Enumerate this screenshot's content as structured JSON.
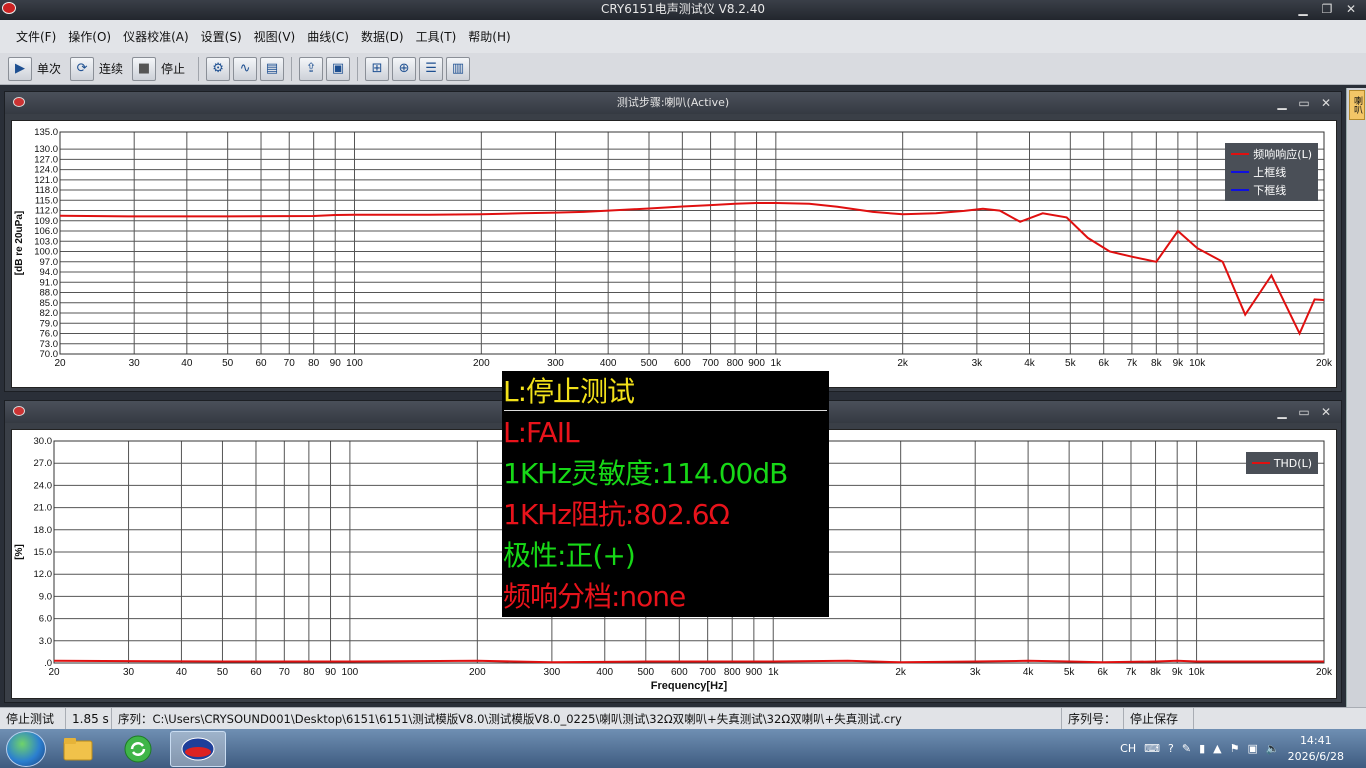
{
  "window": {
    "title": "CRY6151电声测试仪 V8.2.40"
  },
  "menu": [
    "文件(F)",
    "操作(O)",
    "仪器校准(A)",
    "设置(S)",
    "视图(V)",
    "曲线(C)",
    "数据(D)",
    "工具(T)",
    "帮助(H)"
  ],
  "toolbar": {
    "single_label": "单次",
    "continuous_label": "连续",
    "stop_label": "停止"
  },
  "right_tab_label": "喇叭",
  "panel1": {
    "title": "测试步骤:喇叭(Active)"
  },
  "panel2": {
    "title": ""
  },
  "overlay": {
    "status": "L:停止测试",
    "result": "L:FAIL",
    "sensitivity": "1KHz灵敏度:114.00dB",
    "impedance": "1KHz阻抗:802.6Ω",
    "polarity": "极性:正(+)",
    "grading": "频响分档:none"
  },
  "status": {
    "state": "停止测试",
    "time": "1.85 s",
    "sequence": "序列：C:\\Users\\CRYSOUND001\\Desktop\\6151\\6151\\测试模版V8.0\\测试模版V8.0_0225\\喇叭测试\\32Ω双喇叭+失真测试\\32Ω双喇叭+失真测试.cry",
    "serial_label": "序列号：",
    "save": "停止保存"
  },
  "tray": {
    "lang": "CH",
    "time": "14:41",
    "date": "2026/6/28"
  },
  "colors": {
    "fr_curve": "#e01010",
    "upper_limit": "#1010e0",
    "lower_limit": "#1010e0",
    "thd_curve": "#e01010"
  },
  "chart_data": [
    {
      "type": "line",
      "xscale": "log",
      "xlim": [
        20,
        20000
      ],
      "ylim": [
        70,
        135
      ],
      "ylabel": "[dB re 20uPa]",
      "xlabel": "",
      "grid": true,
      "legend": "top-right",
      "x_ticks": [
        {
          "v": 20,
          "l": "20"
        },
        {
          "v": 30,
          "l": "30"
        },
        {
          "v": 40,
          "l": "40"
        },
        {
          "v": 50,
          "l": "50"
        },
        {
          "v": 60,
          "l": "60"
        },
        {
          "v": 70,
          "l": "70"
        },
        {
          "v": 80,
          "l": "80"
        },
        {
          "v": 90,
          "l": "90"
        },
        {
          "v": 100,
          "l": "100"
        },
        {
          "v": 200,
          "l": "200"
        },
        {
          "v": 300,
          "l": "300"
        },
        {
          "v": 400,
          "l": "400"
        },
        {
          "v": 500,
          "l": "500"
        },
        {
          "v": 600,
          "l": "600"
        },
        {
          "v": 700,
          "l": "700"
        },
        {
          "v": 800,
          "l": "800"
        },
        {
          "v": 900,
          "l": "900"
        },
        {
          "v": 1000,
          "l": "1k"
        },
        {
          "v": 2000,
          "l": "2k"
        },
        {
          "v": 3000,
          "l": "3k"
        },
        {
          "v": 4000,
          "l": "4k"
        },
        {
          "v": 5000,
          "l": "5k"
        },
        {
          "v": 6000,
          "l": "6k"
        },
        {
          "v": 7000,
          "l": "7k"
        },
        {
          "v": 8000,
          "l": "8k"
        },
        {
          "v": 9000,
          "l": "9k"
        },
        {
          "v": 10000,
          "l": "10k"
        },
        {
          "v": 20000,
          "l": "20k"
        }
      ],
      "y_ticks": [
        "70.0",
        "73.0",
        "76.0",
        "79.0",
        "82.0",
        "85.0",
        "88.0",
        "91.0",
        "94.0",
        "97.0",
        "100.0",
        "103.0",
        "106.0",
        "109.0",
        "112.0",
        "115.0",
        "118.0",
        "121.0",
        "124.0",
        "127.0",
        "130.0",
        "135.0"
      ],
      "series": [
        {
          "name": "频响响应(L)",
          "color": "#e01010",
          "x": [
            20,
            30,
            50,
            80,
            90,
            100,
            150,
            200,
            250,
            300,
            350,
            400,
            500,
            600,
            700,
            800,
            900,
            1000,
            1200,
            1400,
            1700,
            2000,
            2400,
            2800,
            3100,
            3400,
            3800,
            4300,
            4900,
            5500,
            6200,
            7000,
            8000,
            9000,
            10000,
            11500,
            13000,
            15000,
            17500,
            19000,
            20000
          ],
          "y": [
            110.5,
            110.3,
            110.3,
            110.4,
            110.7,
            110.8,
            110.8,
            110.9,
            111.2,
            111.4,
            111.6,
            112.0,
            112.6,
            113.2,
            113.6,
            114.0,
            114.2,
            114.2,
            114.0,
            113.1,
            111.6,
            110.9,
            111.2,
            111.9,
            112.5,
            112.0,
            108.7,
            111.2,
            110.0,
            104.0,
            100.0,
            98.5,
            97.0,
            106.0,
            101.0,
            97.0,
            81.5,
            93.0,
            76.0,
            86.0,
            85.8
          ]
        },
        {
          "name": "上框线",
          "color": "#1010e0",
          "x": [],
          "y": []
        },
        {
          "name": "下框线",
          "color": "#1010e0",
          "x": [],
          "y": []
        }
      ]
    },
    {
      "type": "line",
      "xscale": "log",
      "xlim": [
        20,
        20000
      ],
      "ylim": [
        0,
        30
      ],
      "ylabel": "[%]",
      "xlabel": "Frequency[Hz]",
      "grid": true,
      "legend": "top-right",
      "x_ticks": [
        {
          "v": 20,
          "l": "20"
        },
        {
          "v": 30,
          "l": "30"
        },
        {
          "v": 40,
          "l": "40"
        },
        {
          "v": 50,
          "l": "50"
        },
        {
          "v": 60,
          "l": "60"
        },
        {
          "v": 70,
          "l": "70"
        },
        {
          "v": 80,
          "l": "80"
        },
        {
          "v": 90,
          "l": "90"
        },
        {
          "v": 100,
          "l": "100"
        },
        {
          "v": 200,
          "l": "200"
        },
        {
          "v": 300,
          "l": "300"
        },
        {
          "v": 400,
          "l": "400"
        },
        {
          "v": 500,
          "l": "500"
        },
        {
          "v": 600,
          "l": "600"
        },
        {
          "v": 700,
          "l": "700"
        },
        {
          "v": 800,
          "l": "800"
        },
        {
          "v": 900,
          "l": "900"
        },
        {
          "v": 1000,
          "l": "1k"
        },
        {
          "v": 2000,
          "l": "2k"
        },
        {
          "v": 3000,
          "l": "3k"
        },
        {
          "v": 4000,
          "l": "4k"
        },
        {
          "v": 5000,
          "l": "5k"
        },
        {
          "v": 6000,
          "l": "6k"
        },
        {
          "v": 7000,
          "l": "7k"
        },
        {
          "v": 8000,
          "l": "8k"
        },
        {
          "v": 9000,
          "l": "9k"
        },
        {
          "v": 10000,
          "l": "10k"
        },
        {
          "v": 20000,
          "l": "20k"
        }
      ],
      "y_ticks": [
        ".0",
        "3.0",
        "6.0",
        "9.0",
        "12.0",
        "15.0",
        "18.0",
        "21.0",
        "24.0",
        "27.0",
        "30.0"
      ],
      "series": [
        {
          "name": "THD(L)",
          "color": "#e01010",
          "x": [
            20,
            50,
            100,
            200,
            300,
            500,
            1000,
            1500,
            2000,
            3000,
            4000,
            5000,
            6000,
            8000,
            9000,
            10000,
            20000
          ],
          "y": [
            0.3,
            0.2,
            0.2,
            0.3,
            0.1,
            0.2,
            0.2,
            0.3,
            0.1,
            0.2,
            0.3,
            0.2,
            0.1,
            0.2,
            0.3,
            0.2,
            0.2
          ]
        }
      ]
    }
  ]
}
